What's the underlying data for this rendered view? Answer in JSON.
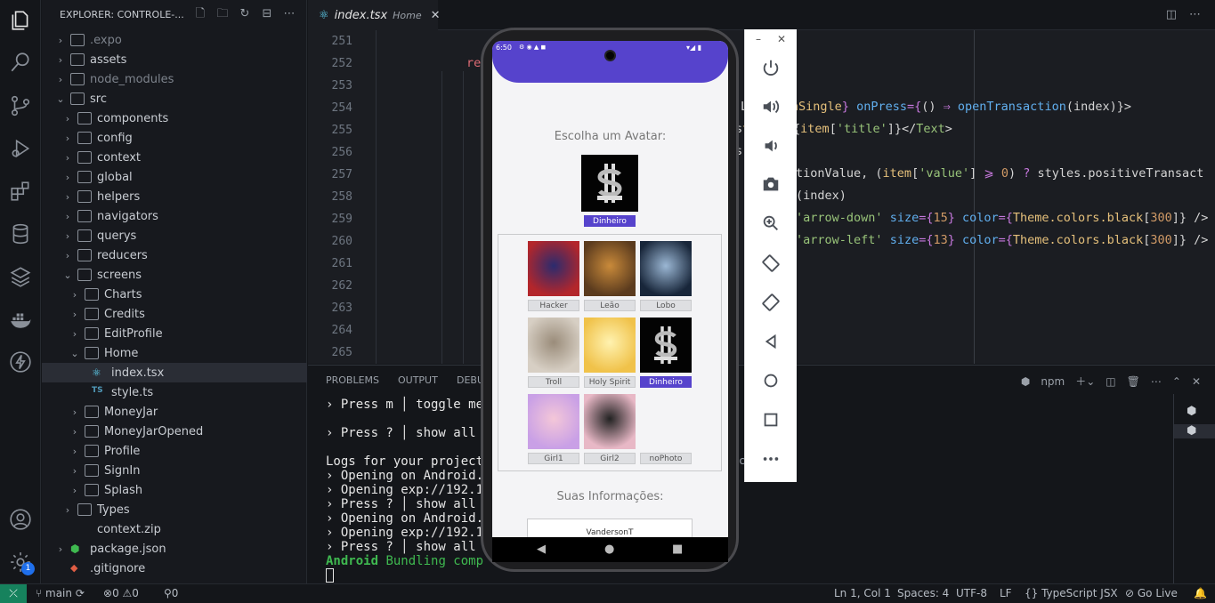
{
  "sidebar": {
    "title": "EXPLORER: CONTROLE-...",
    "items": [
      {
        "label": ".expo",
        "kind": "folder",
        "indent": 1,
        "chev": "›",
        "dim": true
      },
      {
        "label": "assets",
        "kind": "folder",
        "indent": 1,
        "chev": "›"
      },
      {
        "label": "node_modules",
        "kind": "folder",
        "indent": 1,
        "chev": "›",
        "dim": true
      },
      {
        "label": "src",
        "kind": "folder",
        "indent": 1,
        "chev": "⌄"
      },
      {
        "label": "components",
        "kind": "folder",
        "indent": 2,
        "chev": "›"
      },
      {
        "label": "config",
        "kind": "folder",
        "indent": 2,
        "chev": "›"
      },
      {
        "label": "context",
        "kind": "folder",
        "indent": 2,
        "chev": "›"
      },
      {
        "label": "global",
        "kind": "folder",
        "indent": 2,
        "chev": "›"
      },
      {
        "label": "helpers",
        "kind": "folder",
        "indent": 2,
        "chev": "›"
      },
      {
        "label": "navigators",
        "kind": "folder",
        "indent": 2,
        "chev": "›"
      },
      {
        "label": "querys",
        "kind": "folder",
        "indent": 2,
        "chev": "›"
      },
      {
        "label": "reducers",
        "kind": "folder",
        "indent": 2,
        "chev": "›"
      },
      {
        "label": "screens",
        "kind": "folder",
        "indent": 2,
        "chev": "⌄"
      },
      {
        "label": "Charts",
        "kind": "folder",
        "indent": 3,
        "chev": "›"
      },
      {
        "label": "Credits",
        "kind": "folder",
        "indent": 3,
        "chev": "›"
      },
      {
        "label": "EditProfile",
        "kind": "folder",
        "indent": 3,
        "chev": "›"
      },
      {
        "label": "Home",
        "kind": "folder",
        "indent": 3,
        "chev": "⌄"
      },
      {
        "label": "index.tsx",
        "kind": "react",
        "indent": 4,
        "chev": "",
        "selected": true
      },
      {
        "label": "style.ts",
        "kind": "ts",
        "indent": 4,
        "chev": ""
      },
      {
        "label": "MoneyJar",
        "kind": "folder",
        "indent": 3,
        "chev": "›"
      },
      {
        "label": "MoneyJarOpened",
        "kind": "folder",
        "indent": 3,
        "chev": "›"
      },
      {
        "label": "Profile",
        "kind": "folder",
        "indent": 3,
        "chev": "›"
      },
      {
        "label": "SignIn",
        "kind": "folder",
        "indent": 3,
        "chev": "›"
      },
      {
        "label": "Splash",
        "kind": "folder",
        "indent": 3,
        "chev": "›"
      },
      {
        "label": "Types",
        "kind": "folder",
        "indent": 2,
        "chev": "›"
      },
      {
        "label": "context.zip",
        "kind": "file",
        "indent": 2,
        "chev": ""
      },
      {
        "label": "package.json",
        "kind": "json",
        "indent": 1,
        "chev": "›"
      },
      {
        "label": ".gitignore",
        "kind": "git",
        "indent": 1,
        "chev": ""
      }
    ]
  },
  "editor": {
    "tab_label": "index.tsx",
    "tab_desc": "Home",
    "line_numbers": [
      "251",
      "252",
      "253",
      "254",
      "255",
      "256",
      "257",
      "258",
      "259",
      "260",
      "261",
      "262",
      "263",
      "264",
      "265"
    ],
    "frag_252": "re",
    "code": {
      "l254": [
        {
          "t": "L",
          "c": "#d4d4d4"
        },
        {
          "t": "saction",
          "c": "#000"
        },
        {
          "t": "sactionSingle",
          "c": "#e5c07b"
        },
        {
          "t": "} ",
          "c": "#c678dd"
        },
        {
          "t": "onPress",
          "c": "#61afef"
        },
        {
          "t": "={",
          "c": "#c678dd"
        },
        {
          "t": "() ",
          "c": "#d4d4d4"
        },
        {
          "t": "⇒ ",
          "c": "#c678dd"
        },
        {
          "t": "openTransaction",
          "c": "#61afef"
        },
        {
          "t": "(index)}>",
          "c": "#d4d4d4"
        }
      ],
      "l255": [
        {
          "t": "s",
          "c": "#d4d4d4"
        },
        {
          "t": "title",
          "c": "#e5c07b"
        },
        {
          "t": "}>{",
          "c": "#d4d4d4"
        },
        {
          "t": "item",
          "c": "#e5c07b"
        },
        {
          "t": "[",
          "c": "#d4d4d4"
        },
        {
          "t": "'title'",
          "c": "#98c379"
        },
        {
          "t": "]}</",
          "c": "#d4d4d4"
        },
        {
          "t": "Text",
          "c": "#98c379"
        },
        {
          "t": ">",
          "c": "#d4d4d4"
        }
      ],
      "l256": [
        {
          "t": "s",
          "c": "#d4d4d4"
        }
      ],
      "l257": [
        {
          "t": "tionValue, (",
          "c": "#d4d4d4"
        },
        {
          "t": "item",
          "c": "#e5c07b"
        },
        {
          "t": "[",
          "c": "#d4d4d4"
        },
        {
          "t": "'value'",
          "c": "#98c379"
        },
        {
          "t": "] ",
          "c": "#d4d4d4"
        },
        {
          "t": "⩾ ",
          "c": "#c678dd"
        },
        {
          "t": "0",
          "c": "#d19a66"
        },
        {
          "t": ") ",
          "c": "#d4d4d4"
        },
        {
          "t": "? ",
          "c": "#c678dd"
        },
        {
          "t": "styles.positiveTransact",
          "c": "#d4d4d4"
        }
      ],
      "l258": [
        {
          "t": "(index)",
          "c": "#d4d4d4"
        }
      ],
      "l259": [
        {
          "t": "'arrow-down'",
          "c": "#98c379"
        },
        {
          "t": " ",
          "c": "#d4d4d4"
        },
        {
          "t": "size",
          "c": "#61afef"
        },
        {
          "t": "={",
          "c": "#c678dd"
        },
        {
          "t": "15",
          "c": "#d19a66"
        },
        {
          "t": "} ",
          "c": "#c678dd"
        },
        {
          "t": "color",
          "c": "#61afef"
        },
        {
          "t": "={",
          "c": "#c678dd"
        },
        {
          "t": "Theme.colors.black",
          "c": "#e5c07b"
        },
        {
          "t": "[",
          "c": "#d4d4d4"
        },
        {
          "t": "300",
          "c": "#d19a66"
        },
        {
          "t": "]} ",
          "c": "#d4d4d4"
        },
        {
          "t": "/>",
          "c": "#d4d4d4"
        }
      ],
      "l260": [
        {
          "t": "'arrow-left'",
          "c": "#98c379"
        },
        {
          "t": " ",
          "c": "#d4d4d4"
        },
        {
          "t": "size",
          "c": "#61afef"
        },
        {
          "t": "={",
          "c": "#c678dd"
        },
        {
          "t": "13",
          "c": "#d19a66"
        },
        {
          "t": "} ",
          "c": "#c678dd"
        },
        {
          "t": "color",
          "c": "#61afef"
        },
        {
          "t": "={",
          "c": "#c678dd"
        },
        {
          "t": "Theme.colors.black",
          "c": "#e5c07b"
        },
        {
          "t": "[",
          "c": "#d4d4d4"
        },
        {
          "t": "300",
          "c": "#d19a66"
        },
        {
          "t": "]} ",
          "c": "#d4d4d4"
        },
        {
          "t": "/>",
          "c": "#d4d4d4"
        }
      ]
    }
  },
  "panel": {
    "tabs": [
      "PROBLEMS",
      "OUTPUT",
      "DEBU"
    ],
    "terminal_name": "npm",
    "lines": [
      {
        "t": "› Press m │ toggle me",
        "c": "#e6e6e6"
      },
      {
        "t": "",
        "c": "#e6e6e6"
      },
      {
        "t": "› Press ? │ show all",
        "c": "#e6e6e6"
      },
      {
        "t": "",
        "c": "#e6e6e6"
      },
      {
        "t": "Logs for your project",
        "c": "#e6e6e6"
      },
      {
        "t": "› Opening on Android.",
        "c": "#e6e6e6"
      },
      {
        "t": "› Opening exp://192.1",
        "c": "#e6e6e6"
      },
      {
        "t": "› Press ? │ show all",
        "c": "#e6e6e6"
      },
      {
        "t": "› Opening on Android.",
        "c": "#e6e6e6"
      },
      {
        "t": "› Opening exp://192.1",
        "c": "#e6e6e6"
      },
      {
        "t": "› Press ? │ show all",
        "c": "#e6e6e6"
      }
    ],
    "bundling_bold": "Android",
    "bundling_rest": " Bundling comp",
    "frag_c": "c"
  },
  "phone": {
    "time": "6:50",
    "choose_title": "Escolha um Avatar:",
    "selected_avatar": "Dinheiro",
    "avatars": [
      "Hacker",
      "Leão",
      "Lobo",
      "Troll",
      "Holy Spirit",
      "Dinheiro",
      "Girl1",
      "Girl2",
      "noPhoto"
    ],
    "info_title": "Suas Informações:",
    "username": "VandersonT"
  },
  "statusbar": {
    "branch": "main",
    "errors": "0",
    "warnings": "0",
    "ports": "0",
    "position": "Ln 1, Col 1",
    "spaces": "Spaces: 4",
    "encoding": "UTF-8",
    "eol": "LF",
    "language": "TypeScript JSX",
    "golive": "Go Live"
  },
  "activity": {
    "badge": "1"
  },
  "colors": {
    "accent": "#5643cc",
    "remote": "#16825d",
    "badge": "#1f6feb"
  }
}
